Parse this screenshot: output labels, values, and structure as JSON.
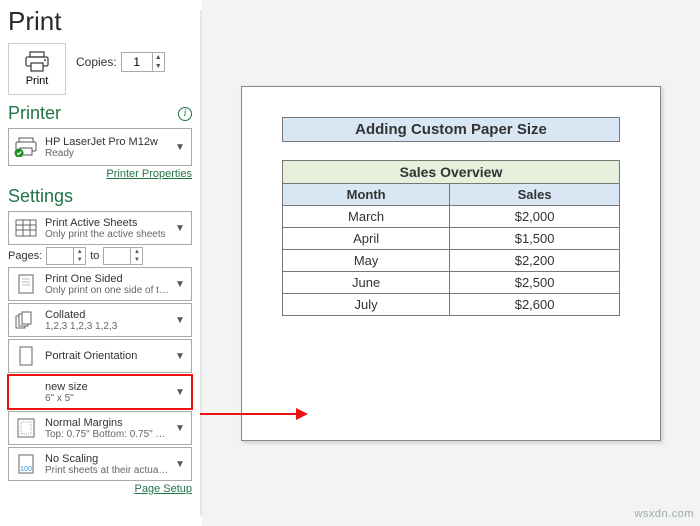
{
  "title": "Print",
  "print": {
    "button_label": "Print",
    "copies_label": "Copies:",
    "copies_value": "1"
  },
  "printer": {
    "section": "Printer",
    "name": "HP LaserJet Pro M12w",
    "status": "Ready",
    "properties_link": "Printer Properties"
  },
  "settings": {
    "section": "Settings",
    "print_what": {
      "line1": "Print Active Sheets",
      "line2": "Only print the active sheets"
    },
    "pages": {
      "label": "Pages:",
      "from": "",
      "to_label": "to",
      "to": ""
    },
    "sides": {
      "line1": "Print One Sided",
      "line2": "Only print on one side of th..."
    },
    "collate": {
      "line1": "Collated",
      "line2": "1,2,3    1,2,3    1,2,3"
    },
    "orientation": {
      "line1": "Portrait Orientation",
      "line2": ""
    },
    "paper": {
      "line1": "new size",
      "line2": "6\" x 5\""
    },
    "margins": {
      "line1": "Normal Margins",
      "line2": "Top: 0.75\" Bottom: 0.75\" Lef..."
    },
    "scaling": {
      "line1": "No Scaling",
      "line2": "Print sheets at their actual size"
    },
    "page_setup_link": "Page Setup"
  },
  "sheet": {
    "caption": "Adding Custom Paper Size",
    "overview": "Sales Overview",
    "col1": "Month",
    "col2": "Sales",
    "rows": [
      {
        "m": "March",
        "s": "$2,000"
      },
      {
        "m": "April",
        "s": "$1,500"
      },
      {
        "m": "May",
        "s": "$2,200"
      },
      {
        "m": "June",
        "s": "$2,500"
      },
      {
        "m": "July",
        "s": "$2,600"
      }
    ]
  },
  "watermark": "wsxdn.com"
}
